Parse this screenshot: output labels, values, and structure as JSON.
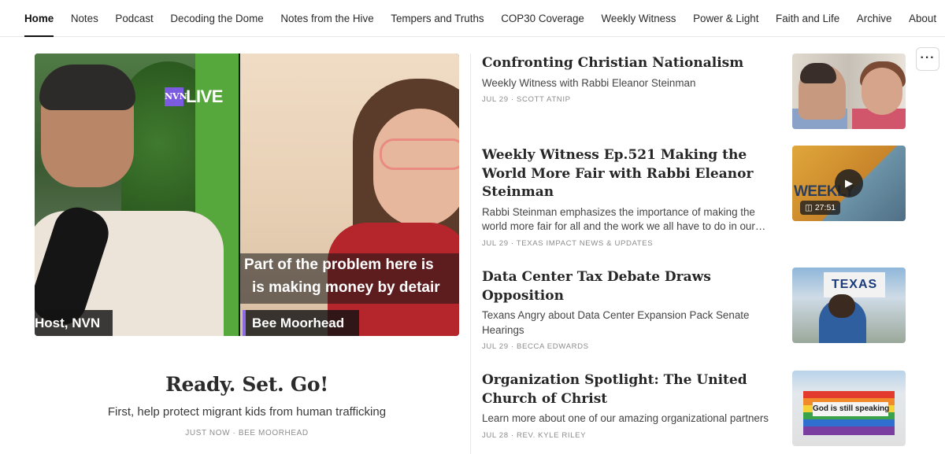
{
  "nav": {
    "items": [
      {
        "label": "Home",
        "active": true
      },
      {
        "label": "Notes"
      },
      {
        "label": "Podcast"
      },
      {
        "label": "Decoding the Dome"
      },
      {
        "label": "Notes from the Hive"
      },
      {
        "label": "Tempers and Truths"
      },
      {
        "label": "COP30 Coverage"
      },
      {
        "label": "Weekly Witness"
      },
      {
        "label": "Power & Light"
      },
      {
        "label": "Faith and Life"
      },
      {
        "label": "Archive"
      },
      {
        "label": "About"
      }
    ]
  },
  "featured": {
    "video": {
      "live_logo": "NVN",
      "live_label": "LIVE",
      "caption_line1": "Part of the problem here is",
      "caption_line2": "is making money by detair",
      "name_left": "Host, NVN",
      "name_right": "Bee Moorhead"
    },
    "title": "Ready. Set. Go!",
    "subtitle": "First, help protect migrant kids from human trafficking",
    "meta": "JUST NOW · BEE MOORHEAD"
  },
  "posts": [
    {
      "title": "Confronting Christian Nationalism",
      "subtitle": "Weekly Witness with Rabbi Eleanor Steinman",
      "meta": "JUL 29 · SCOTT ATNIP"
    },
    {
      "title": "Weekly Witness Ep.521 Making the World More Fair with Rabbi Eleanor Steinman",
      "subtitle": "Rabbi Steinman emphasizes the importance of making the world more fair for all and the work we all have to do in our…",
      "meta": "JUL 29 · TEXAS IMPACT NEWS & UPDATES",
      "thumb": {
        "label": "WEEKLY",
        "duration": "27:51"
      }
    },
    {
      "title": "Data Center Tax Debate Draws Opposition",
      "subtitle": "Texans Angry about Data Center Expansion Pack Senate Hearings",
      "meta": "JUL 29 · BECCA EDWARDS",
      "thumb": {
        "sign": "TEXAS"
      }
    },
    {
      "title": "Organization Spotlight: The United Church of Christ",
      "subtitle": "Learn more about one of our amazing organizational partners",
      "meta": "JUL 28 · REV. KYLE RILEY",
      "thumb": {
        "banner": "God is still speaking"
      }
    }
  ],
  "more_button": "···",
  "icons": {
    "play": "play-icon",
    "video": "video-camera-icon",
    "more": "more-horizontal-icon"
  }
}
